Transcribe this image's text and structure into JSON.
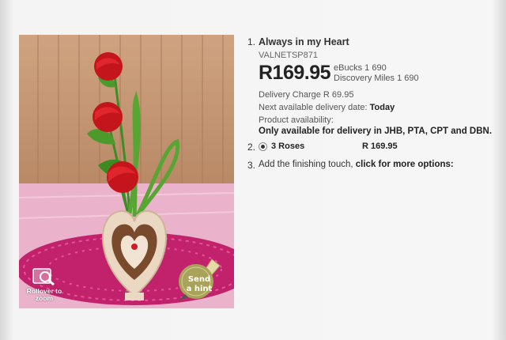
{
  "image": {
    "zoom_hint": "Rollover to zoom",
    "send_hint_line1": "Send",
    "send_hint_line2": "a hint"
  },
  "product": {
    "step_number": "1.",
    "title": "Always in my Heart",
    "sku": "VALNETSP871",
    "price": "R169.95",
    "ebucks": "eBucks 1 690",
    "discovery_miles": "Discovery Miles 1 690",
    "delivery_charge": "Delivery Charge R 69.95",
    "next_delivery_label": "Next available delivery date:",
    "next_delivery_value": "Today",
    "availability_label": "Product availability:",
    "availability_note": "Only available for delivery in JHB, PTA, CPT and DBN."
  },
  "options": {
    "step_number": "2.",
    "selected_label": "3 Roses",
    "selected_price": "R 169.95"
  },
  "finishing": {
    "step_number": "3.",
    "text": "Add the finishing touch,",
    "link": "click for more options:"
  },
  "colors": {
    "rose": "#c4141c",
    "table_pink": "#e9a7c4",
    "doily": "#c2226b",
    "wall": "#c69a78"
  }
}
